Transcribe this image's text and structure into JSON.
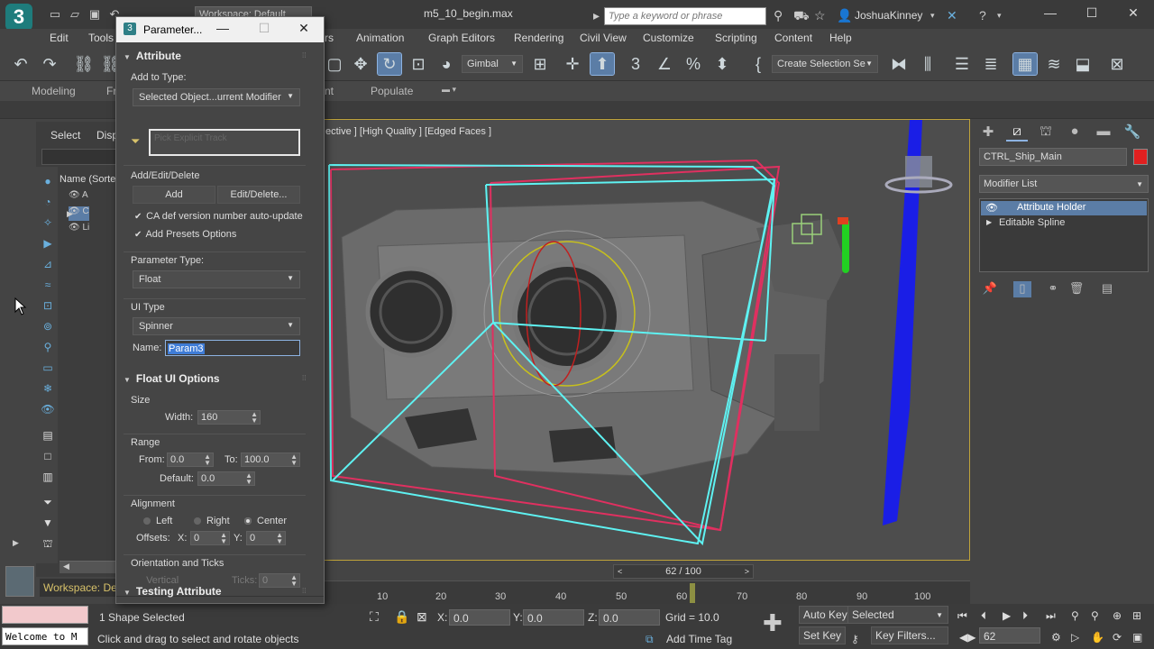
{
  "titlebar": {
    "app_logo": "3",
    "workspace_dropdown": "Workspace: Default",
    "file_title": "m5_10_begin.max",
    "search_placeholder": "Type a keyword or phrase",
    "user_name": "JoshuaKinney",
    "icons": [
      "new-icon",
      "open-icon",
      "save-icon",
      "undo-icon",
      "redo-icon",
      "project-icon",
      "binoculars-icon",
      "star-icon",
      "user-icon",
      "exchange-icon",
      "help-icon"
    ]
  },
  "menu": {
    "items": [
      "Edit",
      "Tools",
      "rs",
      "Animation",
      "Graph Editors",
      "Rendering",
      "Civil View",
      "Customize",
      "Scripting",
      "Content",
      "Help"
    ]
  },
  "toolbar": {
    "reference_coord": "Gimbal",
    "selection_set": "Create Selection Se"
  },
  "ribbon": {
    "tabs": [
      "Modeling",
      "Fr",
      "nt",
      "Populate"
    ]
  },
  "explorer": {
    "tab_select": "Select",
    "tab_display": "Disp",
    "column_header": "Name (Sorte",
    "rows": [
      "A",
      "C",
      "Li"
    ],
    "workspace_label": "Workspace: Default"
  },
  "viewport": {
    "label": "ective ] [High Quality ] [Edged Faces ]"
  },
  "timeline": {
    "frame_display": "62 / 100",
    "current_frame": 62,
    "total_frames": 100,
    "ticks": [
      "10",
      "20",
      "30",
      "40",
      "50",
      "60",
      "70",
      "80",
      "90",
      "100"
    ]
  },
  "status": {
    "selection_info": "1 Shape Selected",
    "prompt": "Click and drag to select and rotate objects",
    "welcome": "Welcome to M",
    "x_label": "X:",
    "x_value": "0.0",
    "y_label": "Y:",
    "y_value": "0.0",
    "z_label": "Z:",
    "z_value": "0.0",
    "grid": "Grid = 10.0",
    "add_time_tag": "Add Time Tag",
    "auto_key": "Auto Key",
    "set_key": "Set Key",
    "key_mode": "Selected",
    "key_filters": "Key Filters...",
    "frame_field": "62"
  },
  "command_panel": {
    "object_name": "CTRL_Ship_Main",
    "object_color": "#e02020",
    "modifier_list": "Modifier List",
    "stack": [
      "Attribute Holder",
      "Editable Spline"
    ]
  },
  "dialog": {
    "title": "Parameter...",
    "attribute": {
      "heading": "Attribute",
      "add_to_type_label": "Add to Type:",
      "add_to_type_value": "Selected Object...urrent Modifier",
      "pick_track_placeholder": "Pick Explicit Track"
    },
    "add_edit_delete": {
      "label": "Add/Edit/Delete",
      "add_button": "Add",
      "edit_button": "Edit/Delete...",
      "ca_def_check": "CA def version number auto-update",
      "presets_check": "Add Presets Options"
    },
    "parameter_type": {
      "label": "Parameter Type:",
      "value": "Float"
    },
    "ui_type": {
      "label": "UI Type",
      "value": "Spinner",
      "name_label": "Name:",
      "name_value": "Param3"
    },
    "float_ui": {
      "heading": "Float UI Options",
      "size_label": "Size",
      "width_label": "Width:",
      "width_value": "160",
      "range_label": "Range",
      "from_label": "From:",
      "from_value": "0.0",
      "to_label": "To:",
      "to_value": "100.0",
      "default_label": "Default:",
      "default_value": "0.0",
      "alignment_label": "Alignment",
      "align_left": "Left",
      "align_right": "Right",
      "align_center": "Center",
      "offsets_label": "Offsets:",
      "offset_x_label": "X:",
      "offset_x_value": "0",
      "offset_y_label": "Y:",
      "offset_y_value": "0",
      "orientation_label": "Orientation and Ticks",
      "orientation_value": "Vertical",
      "ticks_label": "Ticks:",
      "ticks_value": "0"
    },
    "testing": {
      "heading": "Testing Attribute"
    }
  }
}
